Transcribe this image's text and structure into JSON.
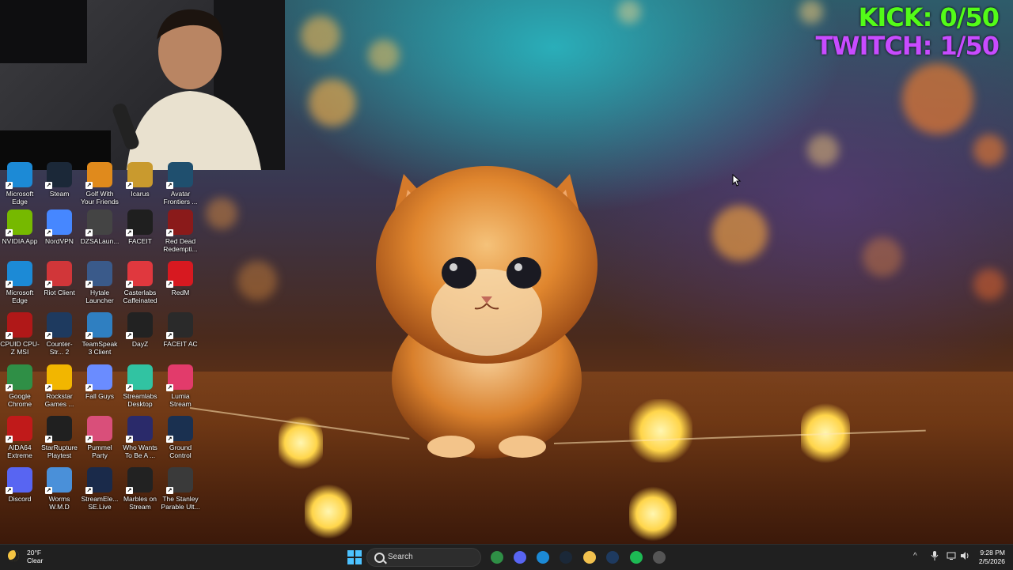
{
  "overlay": {
    "kick_counter": "KICK: 0/50",
    "twitch_counter": "TWITCH: 1/50"
  },
  "desktop_icons": [
    {
      "label": "Microsoft Edge",
      "icon": "edge-icon",
      "color": "#1c8ad6"
    },
    {
      "label": "Steam",
      "icon": "steam-icon",
      "color": "#1b2838"
    },
    {
      "label": "Golf With Your Friends",
      "icon": "golf-icon",
      "color": "#e08a1c"
    },
    {
      "label": "Icarus",
      "icon": "icarus-icon",
      "color": "#c99a2e"
    },
    {
      "label": "Avatar Frontiers ...",
      "icon": "avatar-icon",
      "color": "#1f4f6e"
    },
    {
      "label": "NVIDIA App",
      "icon": "nvidia-icon",
      "color": "#76b900"
    },
    {
      "label": "NordVPN",
      "icon": "nordvpn-icon",
      "color": "#4687ff"
    },
    {
      "label": "DZSALaun...",
      "icon": "dzsa-icon",
      "color": "#444444"
    },
    {
      "label": "FACEIT",
      "icon": "faceit-icon",
      "color": "#1f1f1f"
    },
    {
      "label": "Red Dead Redempti...",
      "icon": "rdr-icon",
      "color": "#8a1a1a"
    },
    {
      "label": "Microsoft Edge",
      "icon": "edge-icon",
      "color": "#1c8ad6"
    },
    {
      "label": "Riot Client",
      "icon": "riot-icon",
      "color": "#d13639"
    },
    {
      "label": "Hytale Launcher",
      "icon": "hytale-icon",
      "color": "#3a5a8a"
    },
    {
      "label": "Casterlabs Caffeinated",
      "icon": "casterlabs-icon",
      "color": "#e0383e"
    },
    {
      "label": "RedM",
      "icon": "redm-icon",
      "color": "#d71920"
    },
    {
      "label": "CPUID CPU-Z MSI",
      "icon": "cpuz-icon",
      "color": "#b01818"
    },
    {
      "label": "Counter-Str... 2",
      "icon": "cs2-icon",
      "color": "#1e3a5f"
    },
    {
      "label": "TeamSpeak 3 Client",
      "icon": "teamspeak-icon",
      "color": "#2f7fc1"
    },
    {
      "label": "DayZ",
      "icon": "dayz-icon",
      "color": "#222222"
    },
    {
      "label": "FACEIT AC",
      "icon": "faceit-ac-icon",
      "color": "#2a2a2a"
    },
    {
      "label": "Google Chrome",
      "icon": "chrome-icon",
      "color": "#2f8f46"
    },
    {
      "label": "Rockstar Games ...",
      "icon": "rockstar-icon",
      "color": "#f2b600"
    },
    {
      "label": "Fall Guys",
      "icon": "fallguys-icon",
      "color": "#6a8cff"
    },
    {
      "label": "Streamlabs Desktop",
      "icon": "streamlabs-icon",
      "color": "#31c3a2"
    },
    {
      "label": "Lumia Stream",
      "icon": "lumia-icon",
      "color": "#e23b6b"
    },
    {
      "label": "AIDA64 Extreme",
      "icon": "aida64-icon",
      "color": "#c01a1a"
    },
    {
      "label": "StarRupture Playtest",
      "icon": "starrupture-icon",
      "color": "#202020"
    },
    {
      "label": "Pummel Party",
      "icon": "pummel-icon",
      "color": "#d94f7a"
    },
    {
      "label": "Who Wants To Be A ...",
      "icon": "millionaire-icon",
      "color": "#2a2a6a"
    },
    {
      "label": "Ground Control",
      "icon": "groundcontrol-icon",
      "color": "#1a3050"
    },
    {
      "label": "Discord",
      "icon": "discord-icon",
      "color": "#5865f2"
    },
    {
      "label": "Worms W.M.D",
      "icon": "worms-icon",
      "color": "#4a90d9"
    },
    {
      "label": "StreamEle... SE.Live",
      "icon": "streamelements-icon",
      "color": "#1a2a4a"
    },
    {
      "label": "Marbles on Stream",
      "icon": "marbles-icon",
      "color": "#222222"
    },
    {
      "label": "The Stanley Parable Ult...",
      "icon": "stanley-icon",
      "color": "#3a3a3a"
    }
  ],
  "taskbar": {
    "weather_temp": "20°F",
    "weather_condition": "Clear",
    "search_placeholder": "Search",
    "time": "9:28 PM",
    "date": "2/5/2026",
    "pinned": [
      {
        "icon": "chrome-icon",
        "color": "#2f8f46"
      },
      {
        "icon": "discord-icon",
        "color": "#5865f2"
      },
      {
        "icon": "edge-icon",
        "color": "#1c8ad6"
      },
      {
        "icon": "steam-icon",
        "color": "#1b2838"
      },
      {
        "icon": "file-explorer-icon",
        "color": "#f2c14e"
      },
      {
        "icon": "app-icon",
        "color": "#1e3a5f"
      },
      {
        "icon": "spotify-icon",
        "color": "#1db954"
      },
      {
        "icon": "app-icon-2",
        "color": "#555555"
      }
    ]
  }
}
